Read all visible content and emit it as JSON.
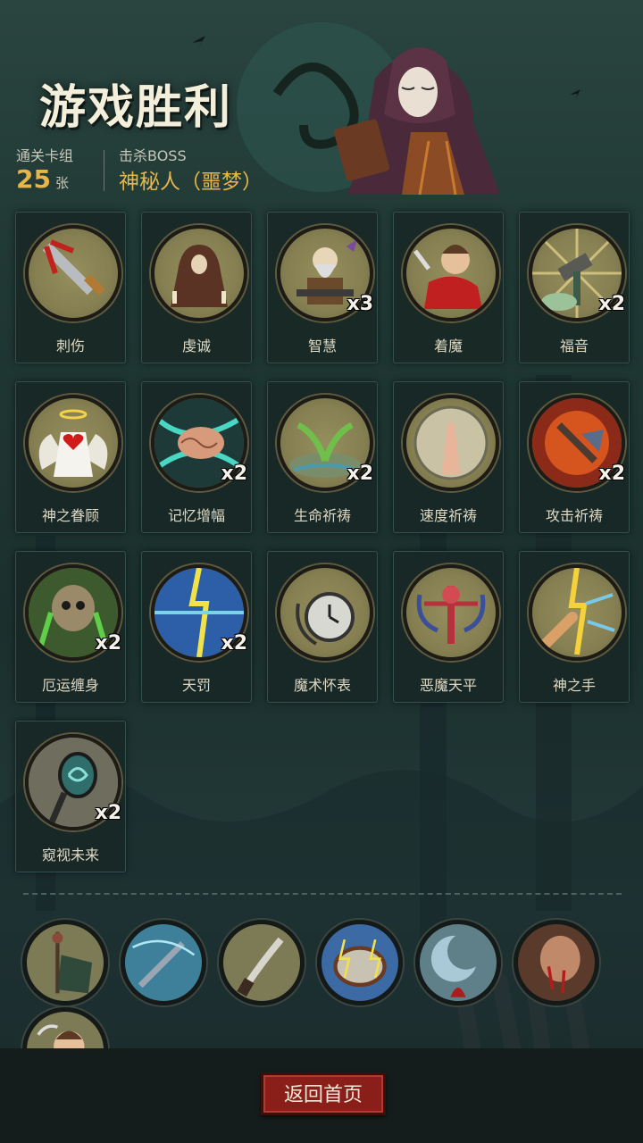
{
  "header": {
    "title": "游戏胜利",
    "deck_label": "通关卡组",
    "deck_count": "25",
    "deck_unit": "张",
    "boss_label": "击杀BOSS",
    "boss_name": "神秘人（噩梦）"
  },
  "cards": [
    {
      "name": "刺伤",
      "count": "",
      "icon": "bloody-sword-icon"
    },
    {
      "name": "虔诚",
      "count": "",
      "icon": "praying-hooded-figure-icon"
    },
    {
      "name": "智慧",
      "count": "x3",
      "icon": "old-sage-icon"
    },
    {
      "name": "着魔",
      "count": "",
      "icon": "possessed-boy-icon"
    },
    {
      "name": "福音",
      "count": "x2",
      "icon": "holy-hammer-icon"
    },
    {
      "name": "神之眷顾",
      "count": "",
      "icon": "angel-heart-icon"
    },
    {
      "name": "记忆增幅",
      "count": "x2",
      "icon": "glowing-brain-icon"
    },
    {
      "name": "生命祈祷",
      "count": "x2",
      "icon": "sprouting-plant-icon"
    },
    {
      "name": "速度祈祷",
      "count": "",
      "icon": "praying-hands-clock-icon"
    },
    {
      "name": "攻击祈祷",
      "count": "x2",
      "icon": "flaming-axe-icon"
    },
    {
      "name": "厄运缠身",
      "count": "x2",
      "icon": "cursed-skull-icon"
    },
    {
      "name": "天罚",
      "count": "x2",
      "icon": "lightning-burst-icon"
    },
    {
      "name": "魔术怀表",
      "count": "",
      "icon": "pocket-watch-icon"
    },
    {
      "name": "恶魔天平",
      "count": "",
      "icon": "demon-scale-icon"
    },
    {
      "name": "神之手",
      "count": "",
      "icon": "lightning-hand-icon"
    },
    {
      "name": "窥视未来",
      "count": "x2",
      "icon": "mystic-mirror-icon"
    }
  ],
  "relics": [
    {
      "icon": "scarecrow-banner-icon"
    },
    {
      "icon": "storm-dagger-icon"
    },
    {
      "icon": "curved-knife-icon"
    },
    {
      "icon": "lightning-compass-icon"
    },
    {
      "icon": "crescent-moon-icon"
    },
    {
      "icon": "bleeding-brute-icon"
    },
    {
      "icon": "frightened-boy-icon"
    }
  ],
  "footer": {
    "return_label": "返回首页"
  },
  "colors": {
    "accent_gold": "#e7b64a",
    "button_red": "#8a1f1a",
    "card_bg": "#182826",
    "icon_bg": "#857f52"
  }
}
